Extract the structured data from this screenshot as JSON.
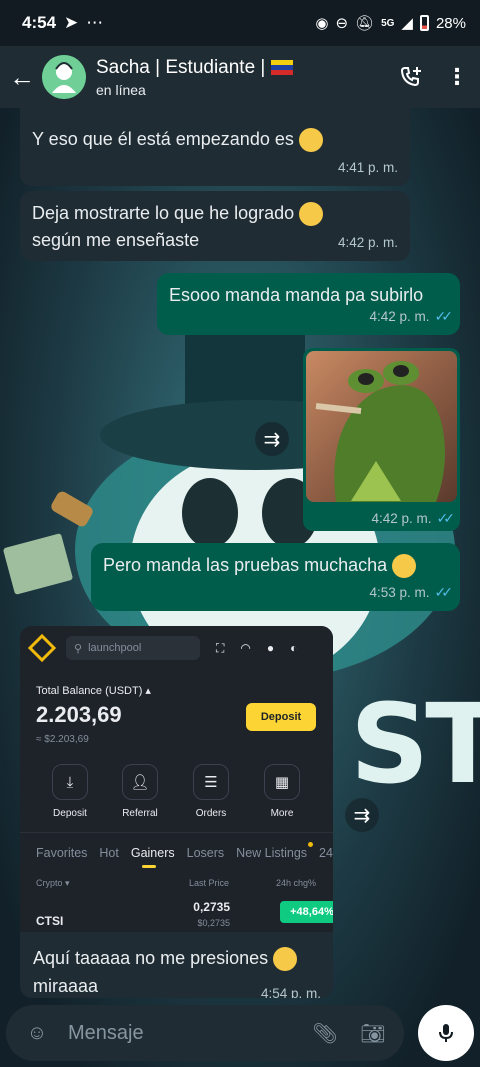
{
  "status_bar": {
    "time": "4:54",
    "battery": "28%",
    "network": "5G"
  },
  "header": {
    "contact_name": "Sacha | Estudiante |",
    "presence": "en línea"
  },
  "messages": [
    {
      "text": "Y eso que él está empezando es",
      "time": "4:41 p. m.",
      "direction": "in"
    },
    {
      "text_line1": "Deja mostrarte  lo que he logrado",
      "text_line2": "según me enseñaste",
      "time": "4:42 p. m.",
      "direction": "in"
    },
    {
      "text": "Esooo manda manda pa subirlo",
      "time": "4:42 p. m.",
      "direction": "out"
    },
    {
      "time": "4:42 p. m.",
      "direction": "out",
      "type": "image"
    },
    {
      "text": "Pero manda las pruebas muchacha",
      "time": "4:53 p. m.",
      "direction": "out"
    }
  ],
  "screenshot": {
    "search_placeholder": "launchpool",
    "balance_label": "Total Balance (USDT)",
    "balance_value": "2.203,69",
    "balance_sub": "≈ $2.203,69",
    "deposit_label": "Deposit",
    "quick_actions": [
      "Deposit",
      "Referral",
      "Orders",
      "More"
    ],
    "tabs": [
      "Favorites",
      "Hot",
      "Gainers",
      "Losers",
      "New Listings",
      "24"
    ],
    "col_crypto": "Crypto",
    "col_last_price": "Last Price",
    "col_change": "24h chg%",
    "coin": "CTSI",
    "price": "0,2735",
    "price_usd": "$0,2735",
    "change": "+48,64%"
  },
  "last_message": {
    "line1": "Aquí taaaaa no me presiones",
    "line2": "miraaaa",
    "time": "4:54 p. m."
  },
  "input": {
    "placeholder": "Mensaje"
  },
  "wallpaper": {
    "text": "ST"
  },
  "colors": {
    "incoming": "#1f2c34",
    "outgoing": "#005c4b",
    "tick_read": "#53bdeb",
    "binance_yellow": "#fcd535",
    "gain_green": "#0ecb81"
  }
}
